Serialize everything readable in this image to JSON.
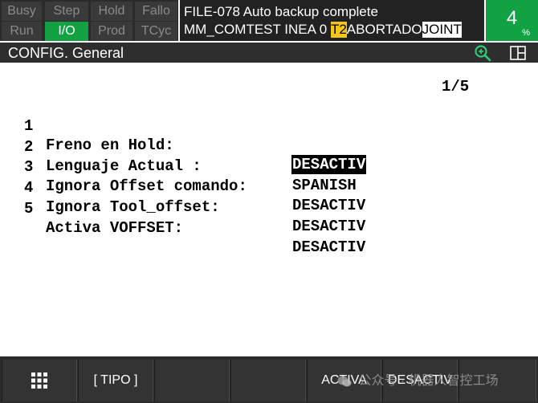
{
  "status_indicators": [
    {
      "label": "Busy",
      "active": false
    },
    {
      "label": "Step",
      "active": false
    },
    {
      "label": "Hold",
      "active": false
    },
    {
      "label": "Fallo",
      "active": false
    },
    {
      "label": "Run",
      "active": false
    },
    {
      "label": "I/O",
      "active": true
    },
    {
      "label": "Prod",
      "active": false
    },
    {
      "label": "TCyc",
      "active": false
    }
  ],
  "message": {
    "line1": "FILE-078 Auto backup complete",
    "line2_program": "MM_COMTEST INEA 0",
    "line2_mode": "T2",
    "line2_status": "ABORTADO",
    "line2_motion": "JOINT"
  },
  "override": {
    "value": "4",
    "unit": "%"
  },
  "title_bar": {
    "title": "CONFIG. General",
    "zoom_icon": "zoom-in-icon",
    "split_icon": "split-screen-icon"
  },
  "content": {
    "page_indicator": "1/5",
    "rows": [
      {
        "num": "1",
        "label": "Freno en Hold:",
        "value": "DESACTIV",
        "selected": true
      },
      {
        "num": "2",
        "label": "Lenguaje Actual :",
        "value": "SPANISH",
        "selected": false
      },
      {
        "num": "3",
        "label": "Ignora Offset comando:",
        "value": "DESACTIV",
        "selected": false
      },
      {
        "num": "4",
        "label": "Ignora Tool_offset:",
        "value": "DESACTIV",
        "selected": false
      },
      {
        "num": "5",
        "label": "Activa VOFFSET:",
        "value": "DESACTIV",
        "selected": false
      }
    ]
  },
  "fkeys": [
    {
      "label": "",
      "icon": "grid-menu-icon"
    },
    {
      "label": "[ TIPO ]"
    },
    {
      "label": ""
    },
    {
      "label": ""
    },
    {
      "label": "ACTIVA"
    },
    {
      "label": "DESACTIV"
    },
    {
      "label": ""
    }
  ],
  "watermark": {
    "text": "公众号 · 机器人智控工场"
  },
  "colors": {
    "active_green": "#12a244",
    "mode_yellow": "#f5c518",
    "panel_dark": "#2b2b2b"
  }
}
